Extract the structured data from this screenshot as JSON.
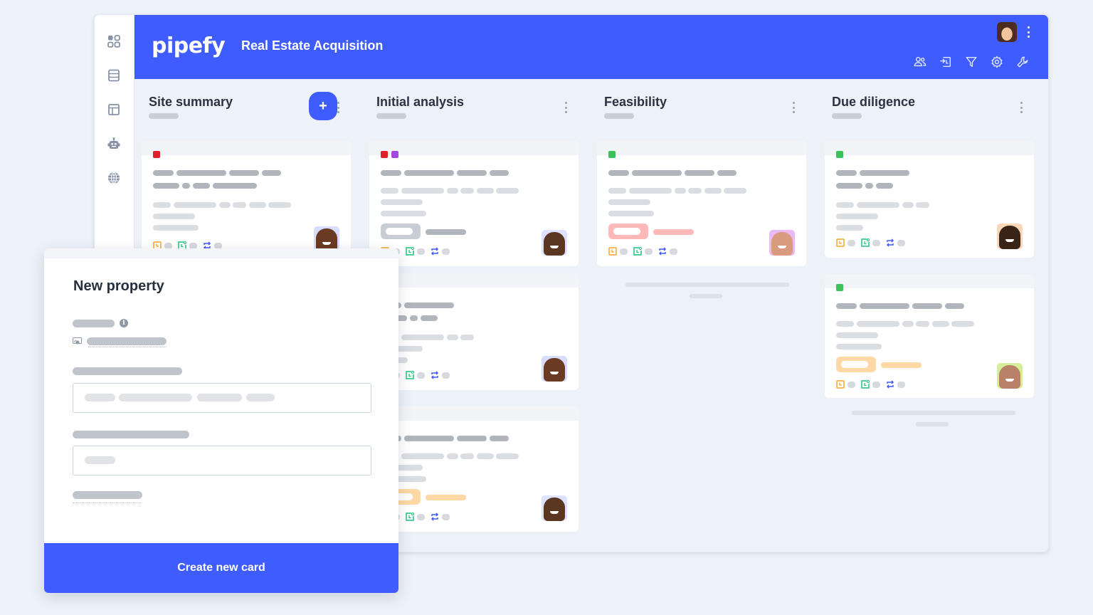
{
  "app": {
    "logo": "pipefy",
    "pipe_title": "Real Estate Acquisition"
  },
  "colors": {
    "brand_blue": "#3e5cff",
    "label_red": "#e0202a",
    "label_purple": "#a347e0",
    "label_green": "#3cc25a",
    "chip_gray": "#c8ccd3",
    "chip_pink": "#ffb8b8",
    "chip_orange": "#ffd8a6",
    "icon_orange": "#f5a623",
    "icon_green": "#1ec27a",
    "icon_blue": "#3e5cff"
  },
  "sidebar": {
    "items": [
      {
        "icon": "apps-grid-icon"
      },
      {
        "icon": "database-icon"
      },
      {
        "icon": "layout-panel-icon"
      },
      {
        "icon": "robot-automation-icon"
      },
      {
        "icon": "globe-icon"
      }
    ]
  },
  "header": {
    "tools": [
      {
        "icon": "members-icon"
      },
      {
        "icon": "import-icon"
      },
      {
        "icon": "filter-icon"
      },
      {
        "icon": "settings-icon"
      },
      {
        "icon": "wrench-icon"
      }
    ],
    "user_avatar": "user-avatar"
  },
  "phases": [
    {
      "title": "Site summary",
      "has_add_button": true,
      "add_label": "+"
    },
    {
      "title": "Initial analysis"
    },
    {
      "title": "Feasibility"
    },
    {
      "title": "Due diligence"
    }
  ],
  "modal": {
    "title": "New property",
    "info_glyph": "i",
    "submit_label": "Create new card"
  }
}
